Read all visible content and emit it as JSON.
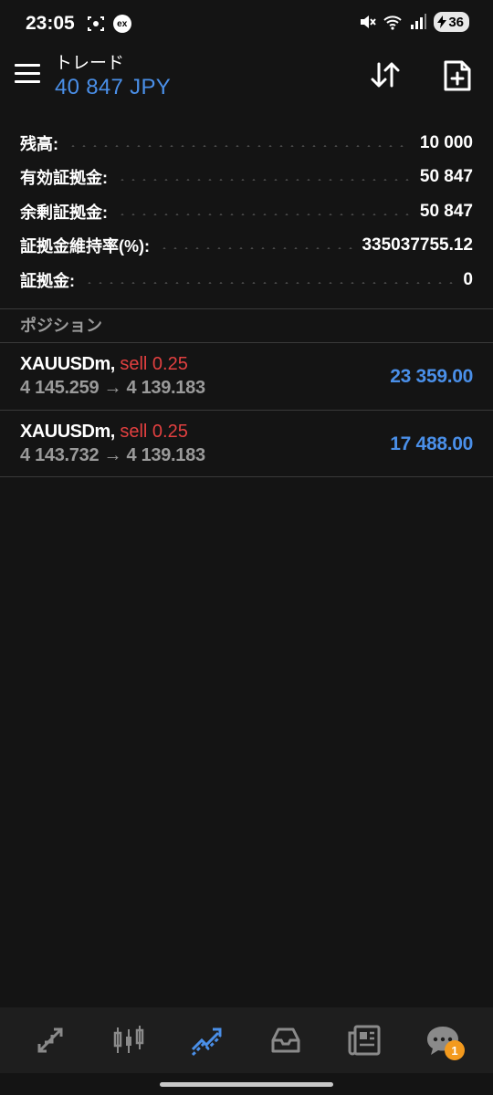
{
  "status_bar": {
    "time": "23:05",
    "ex_label": "ex",
    "battery": "36",
    "icons": [
      "screenshot-icon",
      "ex-badge",
      "mute-icon",
      "wifi-icon",
      "signal-icon",
      "battery-icon"
    ]
  },
  "header": {
    "title": "トレード",
    "balance": "40 847 JPY",
    "menu_icon": "hamburger-menu-icon",
    "sort_icon": "sort-arrows-icon",
    "new_order_icon": "new-order-icon"
  },
  "summary": [
    {
      "label": "残高:",
      "value": "10 000"
    },
    {
      "label": "有効証拠金:",
      "value": "50 847"
    },
    {
      "label": "余剰証拠金:",
      "value": "50 847"
    },
    {
      "label": "証拠金維持率(%):",
      "value": "335037755.12"
    },
    {
      "label": "証拠金:",
      "value": "0"
    }
  ],
  "positions_title": "ポジション",
  "positions": [
    {
      "symbol": "XAUUSDm,",
      "side": "sell 0.25",
      "prices": "4 145.259 → 4 139.183",
      "profit": "23 359.00"
    },
    {
      "symbol": "XAUUSDm,",
      "side": "sell 0.25",
      "prices": "4 143.732 → 4 139.183",
      "profit": "17 488.00"
    }
  ],
  "bottom_nav": {
    "items": [
      "quotes-icon",
      "chart-icon",
      "trade-icon",
      "history-icon",
      "news-icon",
      "chat-icon"
    ],
    "active": "trade-icon",
    "chat_badge": "1"
  },
  "colors": {
    "background": "#141414",
    "accent_blue": "#4a8fe8",
    "sell_red": "#e24040",
    "muted_gray": "#9a9a9a",
    "badge_orange": "#f39a1e"
  }
}
